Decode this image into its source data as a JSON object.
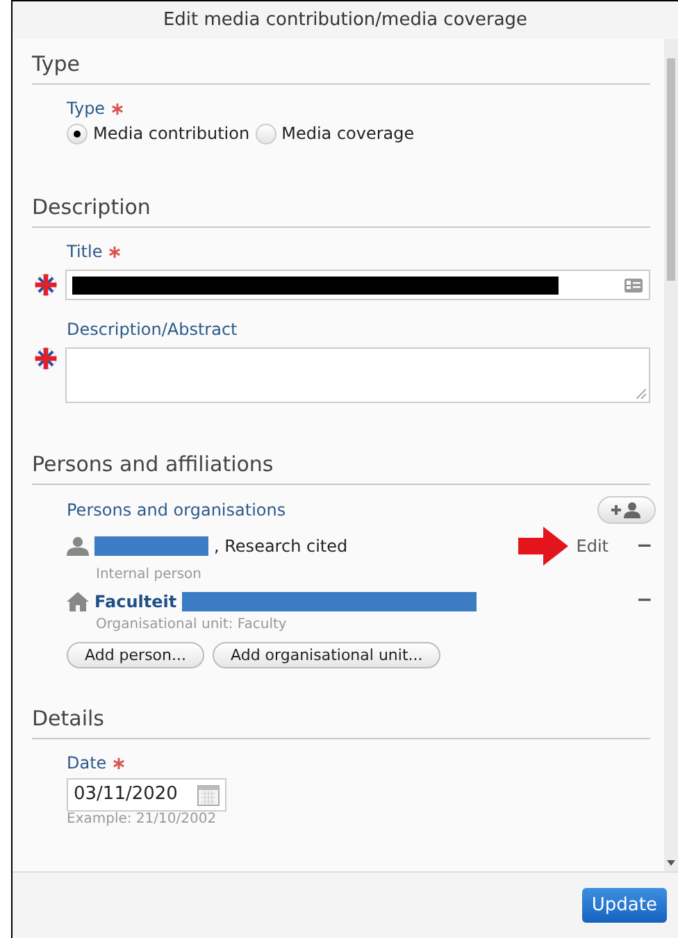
{
  "window": {
    "title": "Edit media contribution/media coverage"
  },
  "sections": [
    {
      "kind": "type",
      "heading": "Type",
      "label": "Type",
      "required": true,
      "options": [
        {
          "label": "Media contribution",
          "selected": true
        },
        {
          "label": "Media coverage",
          "selected": false
        }
      ]
    },
    {
      "kind": "description",
      "heading": "Description",
      "title_label": "Title",
      "title_required": true,
      "abstract_label": "Description/Abstract"
    },
    {
      "kind": "persons",
      "heading": "Persons and affiliations",
      "label": "Persons and organisations",
      "entries": [
        {
          "kind": "person",
          "name_suffix": ", Research cited",
          "subtitle": "Internal person",
          "edit": "Edit",
          "minus": "−"
        },
        {
          "kind": "unit",
          "name": "Faculteit",
          "subtitle": "Organisational unit: Faculty",
          "minus": "−"
        }
      ],
      "buttons": [
        "Add person...",
        "Add organisational unit..."
      ]
    },
    {
      "kind": "details",
      "heading": "Details",
      "date_label": "Date",
      "date_required": true,
      "date_value": "03/11/2020",
      "date_hint": "Example: 21/10/2002"
    }
  ],
  "footer": {
    "button": "Update"
  }
}
